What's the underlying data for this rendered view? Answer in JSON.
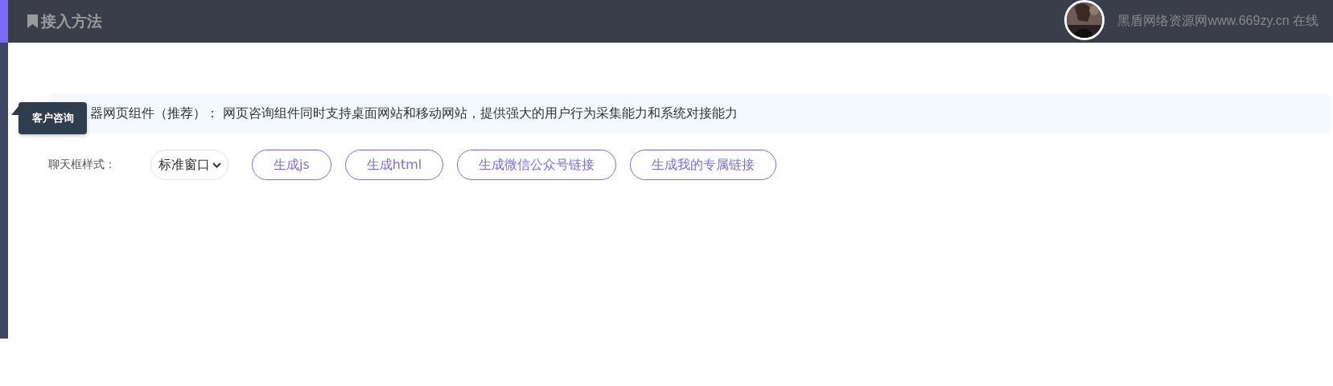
{
  "header": {
    "title": "接入方法",
    "user_text": "黑盾网络资源网www.669zy.cn 在线"
  },
  "sidebar": {
    "tooltip": "客户咨询"
  },
  "notice": "器网页组件（推荐）： 网页咨询组件同时支持桌面网站和移动网站，提供强大的用户行为采集能力和系统对接能力",
  "chat_style": {
    "label": "聊天框样式：",
    "value": "标准窗口"
  },
  "buttons": [
    "生成js",
    "生成html",
    "生成微信公众号链接",
    "生成我的专属链接"
  ]
}
